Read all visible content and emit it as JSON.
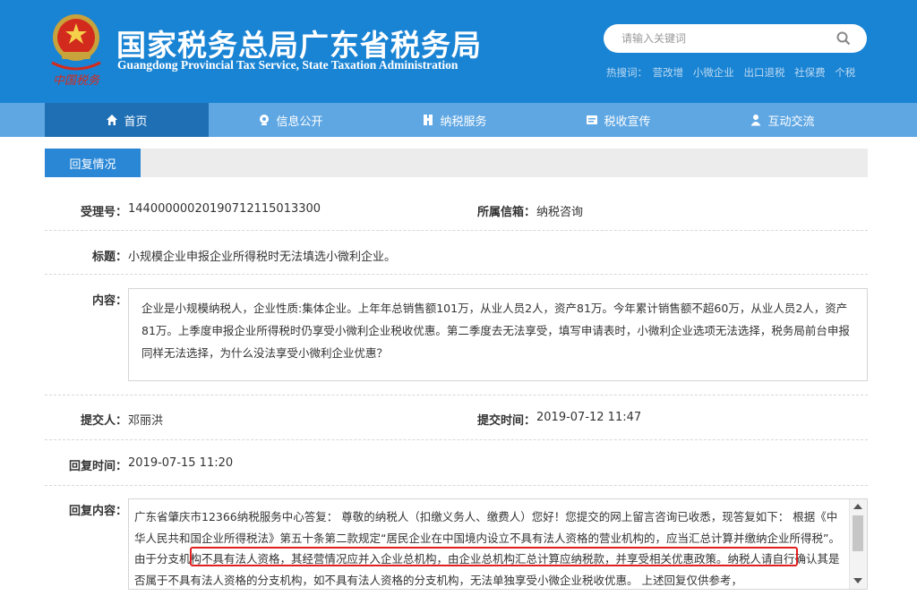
{
  "header": {
    "title": "国家税务总局广东省税务局",
    "subtitle": "Guangdong Provincial Tax Service, State Taxation Administration",
    "emblem_text": "中国税务",
    "search_placeholder": "请输入关键词",
    "hot_label": "热搜词：",
    "hot_words": [
      "营改增",
      "小微企业",
      "出口退税",
      "社保费",
      "个税"
    ]
  },
  "nav": {
    "items": [
      {
        "label": "首页",
        "icon": "home-icon",
        "active": true
      },
      {
        "label": "信息公开",
        "icon": "info-icon"
      },
      {
        "label": "纳税服务",
        "icon": "service-icon"
      },
      {
        "label": "税收宣传",
        "icon": "publicity-icon"
      },
      {
        "label": "互动交流",
        "icon": "user-icon"
      }
    ]
  },
  "tab": {
    "label": "回复情况"
  },
  "fields": {
    "accept_no_label": "受理号：",
    "accept_no": "14400000020190712115013300",
    "mailbox_label": "所属信箱：",
    "mailbox": "纳税咨询",
    "title_label": "标题：",
    "title": "小规模企业申报企业所得税时无法填选小微利企业。",
    "content_label": "内容：",
    "content": "企业是小规模纳税人，企业性质:集体企业。上年年总销售额101万，从业人员2人，资产81万。今年累计销售额不超60万，从业人员2人，资产81万。上季度申报企业所得税时仍享受小微利企业税收优惠。第二季度去无法享受，填写申请表时，小微利企业选项无法选择，税务局前台申报同样无法选择，为什么没法享受小微利企业优惠？",
    "submitter_label": "提交人：",
    "submitter": "邓丽洪",
    "submit_time_label": "提交时间：",
    "submit_time": "2019-07-12 11:47",
    "reply_time_label": "回复时间：",
    "reply_time": "2019-07-15 11:20",
    "reply_content_label": "回复内容：",
    "reply_content": "广东省肇庆市12366纳税服务中心答复： 尊敬的纳税人（扣缴义务人、缴费人）您好！您提交的网上留言咨询已收悉，现答复如下： 根据《中华人民共和国企业所得税法》第五十条第二款规定“居民企业在中国境内设立不具有法人资格的营业机构的，应当汇总计算并缴纳企业所得税”。由于分支机构不具有法人资格，其经营情况应并入企业总机构，由企业总机构汇总计算应纳税款，并享受相关优惠政策。纳税人请自行确认其是否属于不具有法人资格的分支机构，如不具有法人资格的分支机构，无法单独享受小微企业税收优惠。 上述回复仅供参考，"
  },
  "colors": {
    "header_blue": "#1a84d4",
    "nav_blue": "#5fa7e3",
    "nav_active": "#1f6fb5",
    "tab_blue": "#2a87d6",
    "highlight_red": "#e02020"
  }
}
